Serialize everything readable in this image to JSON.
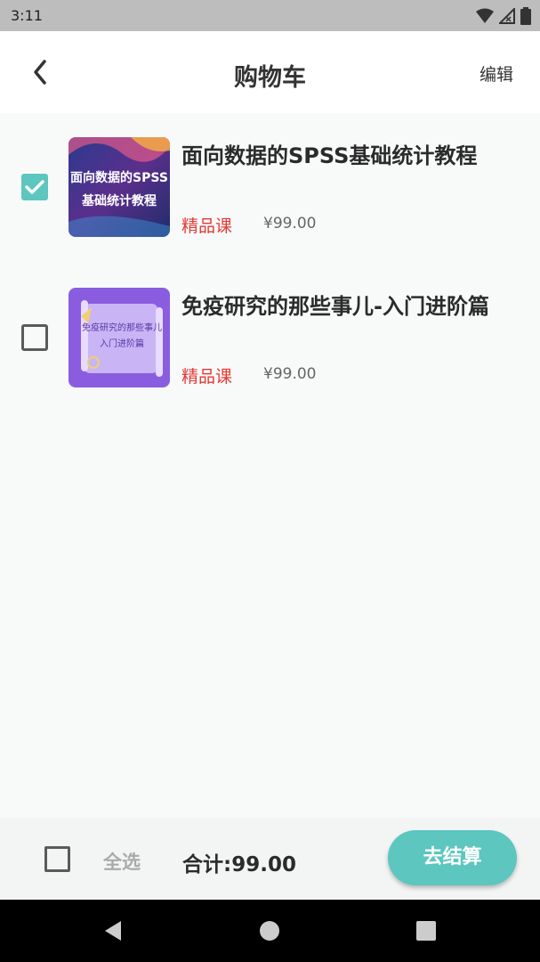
{
  "status_bar": {
    "time": "3:11"
  },
  "header": {
    "title": "购物车",
    "edit_label": "编辑"
  },
  "cart": {
    "items": [
      {
        "title": "面向数据的SPSS基础统计教程",
        "thumb_text_line1": "面向数据的SPSS",
        "thumb_text_line2": "基础统计教程",
        "tag": "精品课",
        "price": "¥99.00",
        "checked": true
      },
      {
        "title": "免疫研究的那些事儿-入门进阶篇",
        "thumb_text_line1": "免疫研究的那些事儿",
        "thumb_text_line2": "入门进阶篇",
        "tag": "精品课",
        "price": "¥99.00",
        "checked": false
      }
    ]
  },
  "footer": {
    "select_all_label": "全选",
    "total_label": "合计:99.00",
    "checkout_label": "去结算"
  },
  "colors": {
    "accent": "#5cc6bf",
    "tag_red": "#e53935"
  }
}
